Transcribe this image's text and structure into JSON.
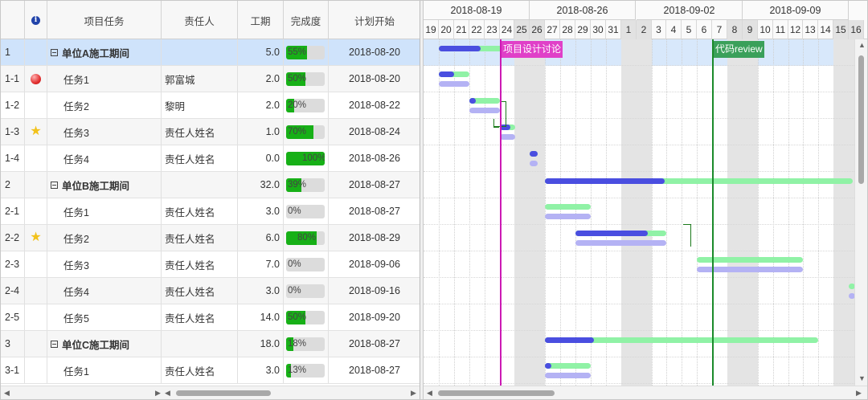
{
  "grid": {
    "columns": {
      "id": "",
      "info_icon": "info-icon",
      "task": "项目任务",
      "owner": "责任人",
      "duration": "工期",
      "progress": "完成度",
      "start": "计划开始"
    },
    "rows": [
      {
        "id": "1",
        "task": "单位A施工期间",
        "owner": "",
        "duration": "5.0",
        "progress": 55,
        "progress_text": "55%",
        "start": "2018-08-20",
        "group": true,
        "icon": ""
      },
      {
        "id": "1-1",
        "task": "任务1",
        "owner": "郭富城",
        "duration": "2.0",
        "progress": 50,
        "progress_text": "50%",
        "start": "2018-08-20",
        "group": false,
        "icon": "red-ball-icon"
      },
      {
        "id": "1-2",
        "task": "任务2",
        "owner": "黎明",
        "duration": "2.0",
        "progress": 20,
        "progress_text": "20%",
        "start": "2018-08-22",
        "group": false,
        "icon": ""
      },
      {
        "id": "1-3",
        "task": "任务3",
        "owner": "责任人姓名",
        "duration": "1.0",
        "progress": 70,
        "progress_text": "70%",
        "start": "2018-08-24",
        "group": false,
        "icon": "star-icon"
      },
      {
        "id": "1-4",
        "task": "任务4",
        "owner": "责任人姓名",
        "duration": "0.0",
        "progress": 100,
        "progress_text": "100%",
        "start": "2018-08-26",
        "group": false,
        "icon": ""
      },
      {
        "id": "2",
        "task": "单位B施工期间",
        "owner": "",
        "duration": "32.0",
        "progress": 39,
        "progress_text": "39%",
        "start": "2018-08-27",
        "group": true,
        "icon": ""
      },
      {
        "id": "2-1",
        "task": "任务1",
        "owner": "责任人姓名",
        "duration": "3.0",
        "progress": 0,
        "progress_text": "0%",
        "start": "2018-08-27",
        "group": false,
        "icon": ""
      },
      {
        "id": "2-2",
        "task": "任务2",
        "owner": "责任人姓名",
        "duration": "6.0",
        "progress": 80,
        "progress_text": "80%",
        "start": "2018-08-29",
        "group": false,
        "icon": "star-icon"
      },
      {
        "id": "2-3",
        "task": "任务3",
        "owner": "责任人姓名",
        "duration": "7.0",
        "progress": 0,
        "progress_text": "0%",
        "start": "2018-09-06",
        "group": false,
        "icon": ""
      },
      {
        "id": "2-4",
        "task": "任务4",
        "owner": "责任人姓名",
        "duration": "3.0",
        "progress": 0,
        "progress_text": "0%",
        "start": "2018-09-16",
        "group": false,
        "icon": ""
      },
      {
        "id": "2-5",
        "task": "任务5",
        "owner": "责任人姓名",
        "duration": "14.0",
        "progress": 50,
        "progress_text": "50%",
        "start": "2018-09-20",
        "group": false,
        "icon": ""
      },
      {
        "id": "3",
        "task": "单位C施工期间",
        "owner": "",
        "duration": "18.0",
        "progress": 18,
        "progress_text": "18%",
        "start": "2018-08-27",
        "group": true,
        "icon": ""
      },
      {
        "id": "3-1",
        "task": "任务1",
        "owner": "责任人姓名",
        "duration": "3.0",
        "progress": 13,
        "progress_text": "13%",
        "start": "2018-08-27",
        "group": false,
        "icon": ""
      }
    ],
    "selected_row": "1"
  },
  "timeline": {
    "weeks": [
      "2018-08-19",
      "2018-08-26",
      "2018-09-02",
      "2018-09-09"
    ],
    "days": [
      "19",
      "20",
      "21",
      "22",
      "23",
      "24",
      "25",
      "26",
      "27",
      "28",
      "29",
      "30",
      "31",
      "1",
      "2",
      "3",
      "4",
      "5",
      "6",
      "7",
      "8",
      "9",
      "10",
      "11",
      "12",
      "13",
      "14",
      "15",
      "16"
    ],
    "weekend_days": [
      "25",
      "26",
      "1",
      "2",
      "8",
      "9",
      "15",
      "16"
    ],
    "milestones": [
      {
        "label": "项目设计讨论",
        "date": "2018-08-24",
        "color": "#e040c8",
        "line_color": "#cc1ab4"
      },
      {
        "label": "代码review",
        "date": "2018-09-07",
        "color": "#3aa05a",
        "line_color": "#1a8a2a"
      }
    ]
  },
  "colors": {
    "plan_bar": "#b4b2f4",
    "actual_bar": "#90f2a6",
    "done_bar": "#4a4ee0",
    "progress_fill": "#17b017",
    "selected_row": "#cfe3fb"
  }
}
